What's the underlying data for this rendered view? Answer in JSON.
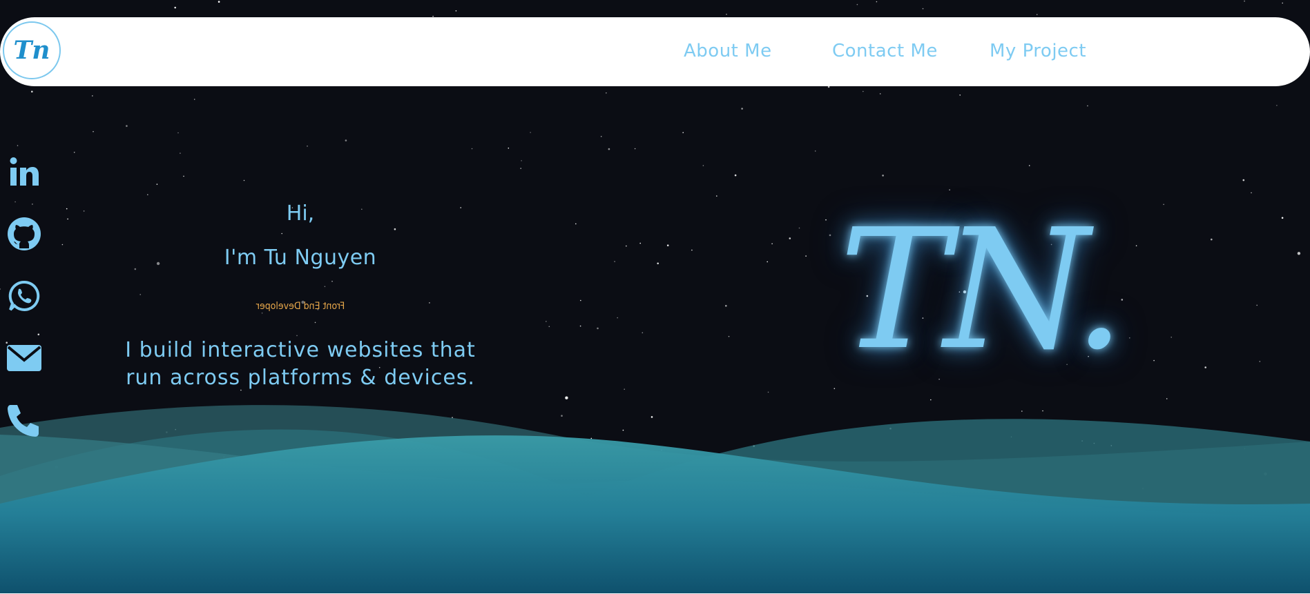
{
  "header": {
    "logo_text": "Tn",
    "nav": [
      {
        "label": "About Me"
      },
      {
        "label": "Contact Me"
      },
      {
        "label": "My Project"
      }
    ]
  },
  "social": [
    {
      "icon": "linkedin-icon"
    },
    {
      "icon": "github-icon"
    },
    {
      "icon": "whatsapp-icon"
    },
    {
      "icon": "email-icon"
    },
    {
      "icon": "phone-icon"
    }
  ],
  "intro": {
    "greeting": "Hi,",
    "name": "I'm Tu Nguyen",
    "role": "Front End Developer",
    "tagline": "I build interactive websites that run across platforms & devices."
  },
  "monogram": "TN.",
  "colors": {
    "background": "#0b0d14",
    "accent": "#7ecbf2",
    "role": "#e6a64a",
    "wave": "#2a8fa0"
  }
}
